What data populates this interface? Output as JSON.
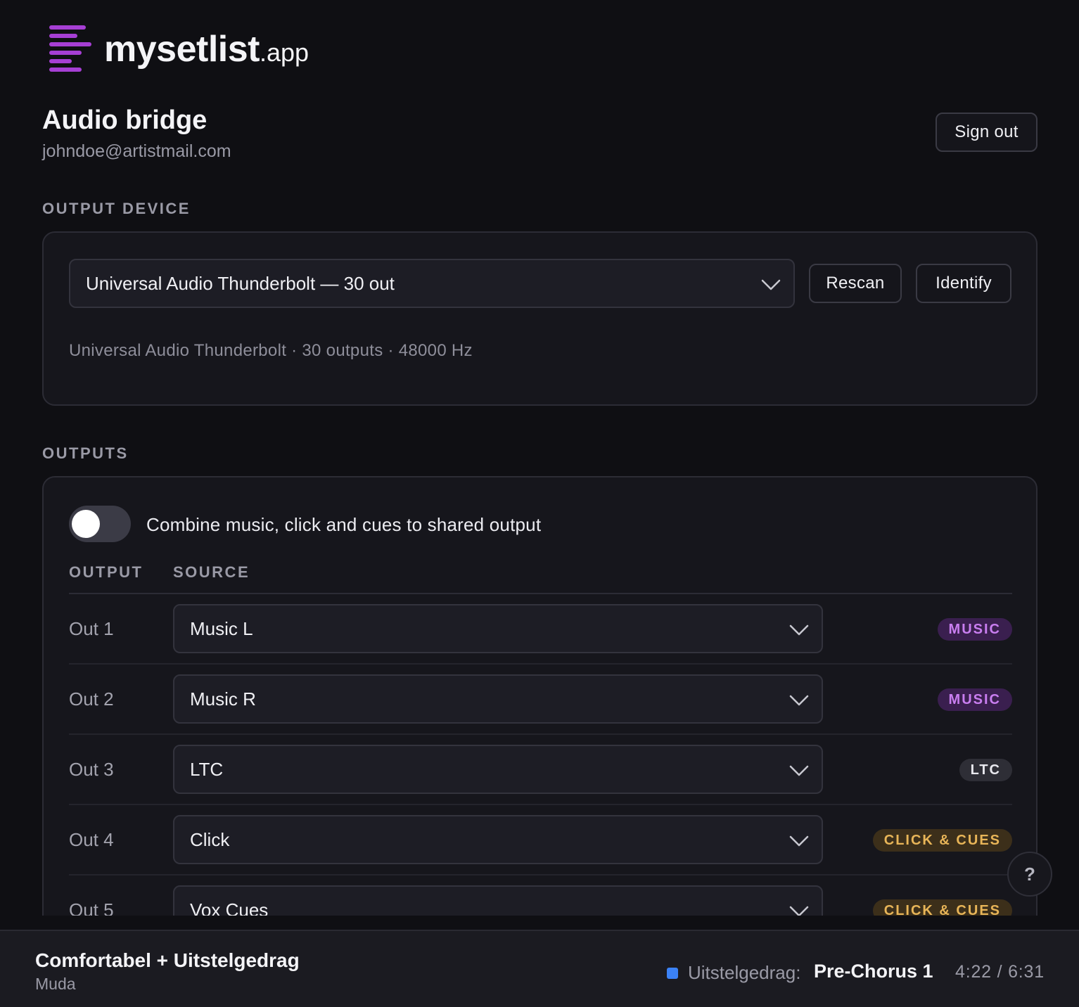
{
  "brand": {
    "name": "mysetlist",
    "tld": ".app",
    "accent_color": "#a63fd4"
  },
  "header": {
    "title": "Audio bridge",
    "email": "johndoe@artistmail.com",
    "sign_out_label": "Sign out"
  },
  "output_device": {
    "section_label": "OUTPUT DEVICE",
    "selected": "Universal Audio Thunderbolt — 30 out",
    "rescan_label": "Rescan",
    "identify_label": "Identify",
    "info": "Universal Audio Thunderbolt · 30 outputs · 48000 Hz"
  },
  "outputs": {
    "section_label": "OUTPUTS",
    "combine_toggle": {
      "label": "Combine music, click and cues to shared output",
      "on": false
    },
    "columns": {
      "output": "OUTPUT",
      "source": "SOURCE"
    },
    "rows": [
      {
        "output": "Out 1",
        "source": "Music L",
        "badge": "MUSIC"
      },
      {
        "output": "Out 2",
        "source": "Music R",
        "badge": "MUSIC"
      },
      {
        "output": "Out 3",
        "source": "LTC",
        "badge": "LTC"
      },
      {
        "output": "Out 4",
        "source": "Click",
        "badge": "CLICK & CUES"
      },
      {
        "output": "Out 5",
        "source": "Vox Cues",
        "badge": "CLICK & CUES"
      }
    ]
  },
  "help": {
    "label": "?"
  },
  "now_playing": {
    "title": "Comfortabel + Uitstelgedrag",
    "artist": "Muda",
    "song": "Uitstelgedrag:",
    "section": "Pre-Chorus 1",
    "time": "4:22 / 6:31",
    "marker_color": "#3b82f6"
  }
}
